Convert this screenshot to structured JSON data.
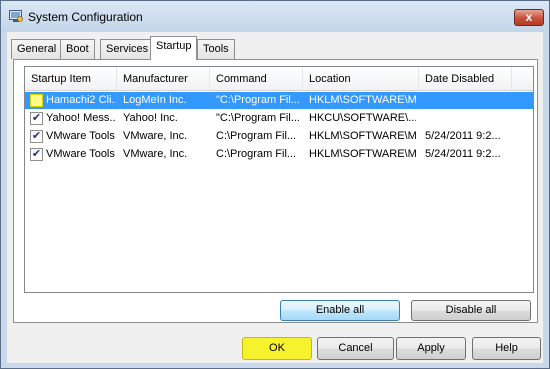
{
  "window": {
    "title": "System Configuration",
    "close_glyph": "x"
  },
  "tabs": [
    {
      "label": "General"
    },
    {
      "label": "Boot"
    },
    {
      "label": "Services"
    },
    {
      "label": "Startup",
      "active": true
    },
    {
      "label": "Tools"
    }
  ],
  "table": {
    "columns": [
      "Startup Item",
      "Manufacturer",
      "Command",
      "Location",
      "Date Disabled"
    ],
    "rows": [
      {
        "checked": false,
        "selected": true,
        "item": "Hamachi2 Cli...",
        "manufacturer": "LogMeIn Inc.",
        "command": "\"C:\\Program Fil...",
        "location": "HKLM\\SOFTWARE\\M...",
        "date": ""
      },
      {
        "checked": true,
        "selected": false,
        "item": "Yahoo! Mess...",
        "manufacturer": "Yahoo! Inc.",
        "command": "\"C:\\Program Fil...",
        "location": "HKCU\\SOFTWARE\\...",
        "date": ""
      },
      {
        "checked": true,
        "selected": false,
        "item": "VMware Tools",
        "manufacturer": "VMware, Inc.",
        "command": "C:\\Program Fil...",
        "location": "HKLM\\SOFTWARE\\M...",
        "date": "5/24/2011 9:2..."
      },
      {
        "checked": true,
        "selected": false,
        "item": "VMware Tools",
        "manufacturer": "VMware, Inc.",
        "command": "C:\\Program Fil...",
        "location": "HKLM\\SOFTWARE\\M...",
        "date": "5/24/2011 9:2..."
      }
    ]
  },
  "actions": {
    "enable_all": "Enable all",
    "disable_all": "Disable all"
  },
  "dialog_buttons": {
    "ok": "OK",
    "cancel": "Cancel",
    "apply": "Apply",
    "help": "Help"
  },
  "colors": {
    "selection": "#3399ff",
    "highlight": "#f7f22e",
    "titlebar": "#c3d5ea"
  },
  "icons": {
    "app": "system-config-icon",
    "check": "checkmark-icon"
  }
}
